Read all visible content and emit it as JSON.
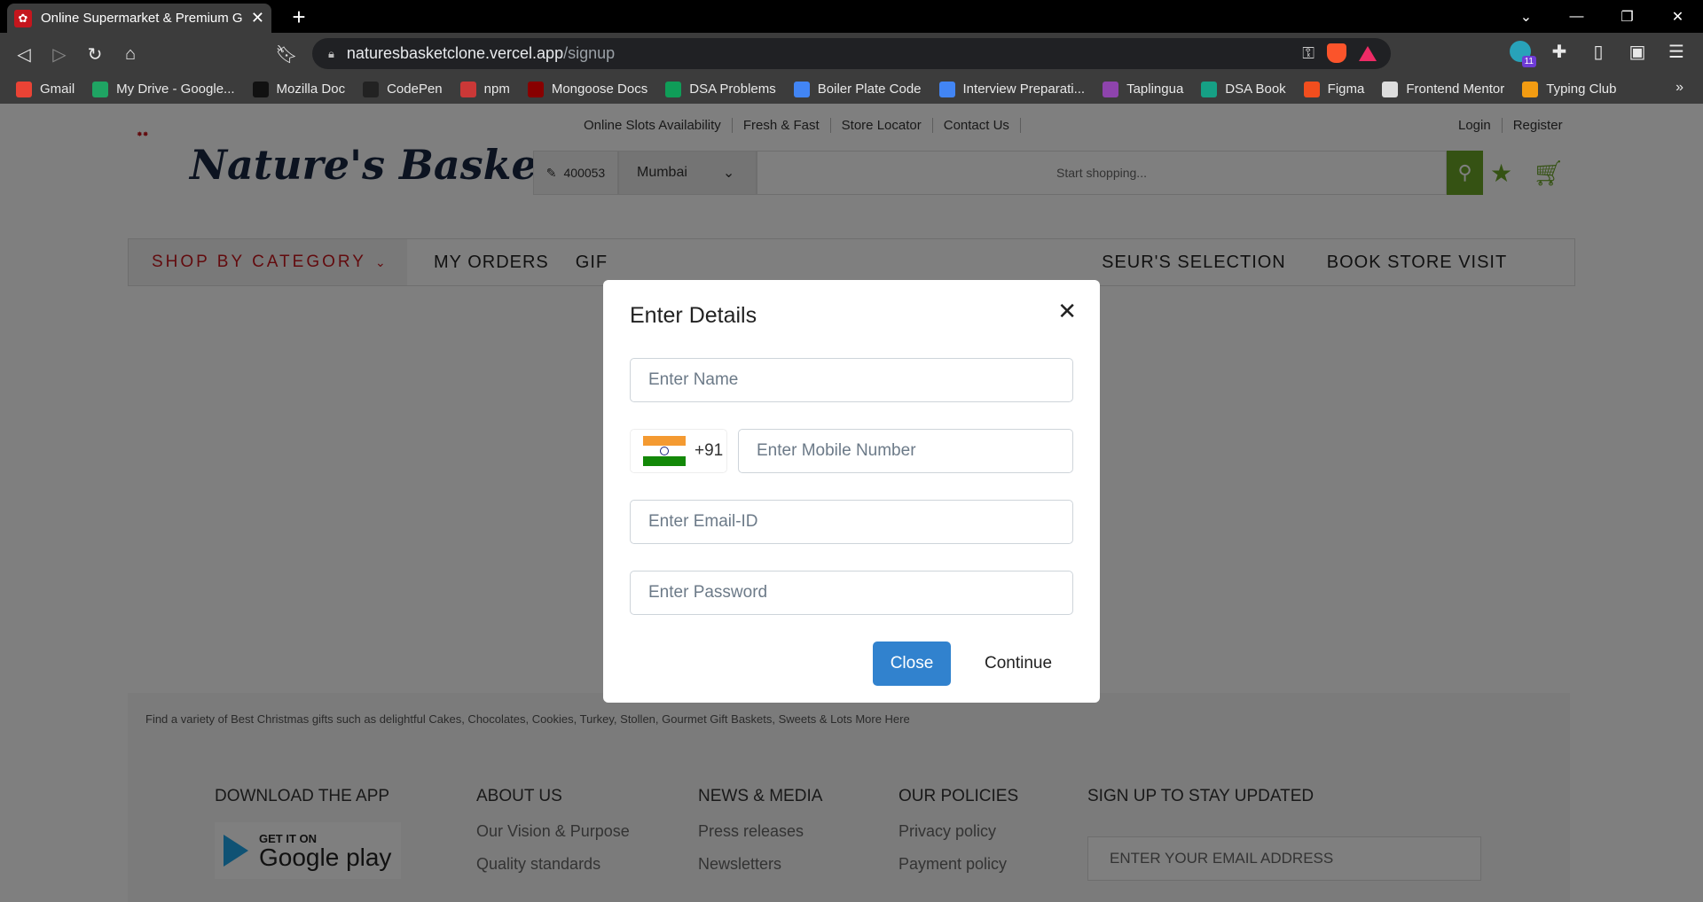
{
  "browser": {
    "tab_title": "Online Supermarket & Premium G",
    "url_host": "naturesbasketclone.vercel.app",
    "url_path": "/signup",
    "ext_badge": "11",
    "bookmarks": [
      {
        "label": "Gmail",
        "icon": "gmail-icon",
        "color": "#ea4335"
      },
      {
        "label": "My Drive - Google...",
        "icon": "drive-icon",
        "color": "#1fa463"
      },
      {
        "label": "Mozilla Doc",
        "icon": "mdn-icon",
        "color": "#111111"
      },
      {
        "label": "CodePen",
        "icon": "codepen-icon",
        "color": "#222222"
      },
      {
        "label": "npm",
        "icon": "npm-icon",
        "color": "#cb3837"
      },
      {
        "label": "Mongoose Docs",
        "icon": "mongoose-icon",
        "color": "#880000"
      },
      {
        "label": "DSA Problems",
        "icon": "sheets-icon",
        "color": "#0f9d58"
      },
      {
        "label": "Boiler Plate Code",
        "icon": "docs-icon",
        "color": "#4285f4"
      },
      {
        "label": "Interview Preparati...",
        "icon": "docs-icon",
        "color": "#4285f4"
      },
      {
        "label": "Taplingua",
        "icon": "star-icon",
        "color": "#8e44ad"
      },
      {
        "label": "DSA Book",
        "icon": "book-icon",
        "color": "#16a085"
      },
      {
        "label": "Figma",
        "icon": "figma-icon",
        "color": "#f24e1e"
      },
      {
        "label": "Frontend Mentor",
        "icon": "frontend-mentor-icon",
        "color": "#dddddd"
      },
      {
        "label": "Typing Club",
        "icon": "fire-icon",
        "color": "#f39c12"
      }
    ],
    "bookmarks_more": "»"
  },
  "header": {
    "logo_text": "Nature's Basket",
    "top_links": [
      "Online Slots Availability",
      "Fresh & Fast",
      "Store Locator",
      "Contact Us"
    ],
    "account_links": [
      "Login",
      "Register"
    ],
    "pincode": "400053",
    "city": "Mumbai",
    "search_placeholder": "Start shopping...",
    "accent_color": "#6aa526"
  },
  "category_nav": {
    "shop_by_category": "SHOP BY CATEGORY",
    "items": [
      "MY ORDERS",
      "GIF",
      "SEUR'S SELECTION",
      "BOOK STORE VISIT"
    ]
  },
  "footer": {
    "note": "Find a variety of Best Christmas gifts such as delightful Cakes, Chocolates, Cookies, Turkey, Stollen, Gourmet Gift Baskets, Sweets & Lots More Here",
    "download_app": "DOWNLOAD THE APP",
    "gplay_small": "GET IT ON",
    "gplay_big": "Google play",
    "about_us": {
      "title": "ABOUT US",
      "links": [
        "Our Vision & Purpose",
        "Quality standards"
      ]
    },
    "news_media": {
      "title": "NEWS & MEDIA",
      "links": [
        "Press releases",
        "Newsletters"
      ]
    },
    "our_policies": {
      "title": "OUR POLICIES",
      "links": [
        "Privacy policy",
        "Payment policy"
      ]
    },
    "signup": {
      "title": "SIGN UP TO STAY UPDATED",
      "placeholder": "ENTER YOUR EMAIL ADDRESS"
    }
  },
  "modal": {
    "title": "Enter Details",
    "name_placeholder": "Enter Name",
    "country_code": "+91",
    "mobile_placeholder": "Enter Mobile Number",
    "email_placeholder": "Enter Email-ID",
    "password_placeholder": "Enter Password",
    "close_label": "Close",
    "continue_label": "Continue",
    "primary_color": "#3182ce"
  }
}
